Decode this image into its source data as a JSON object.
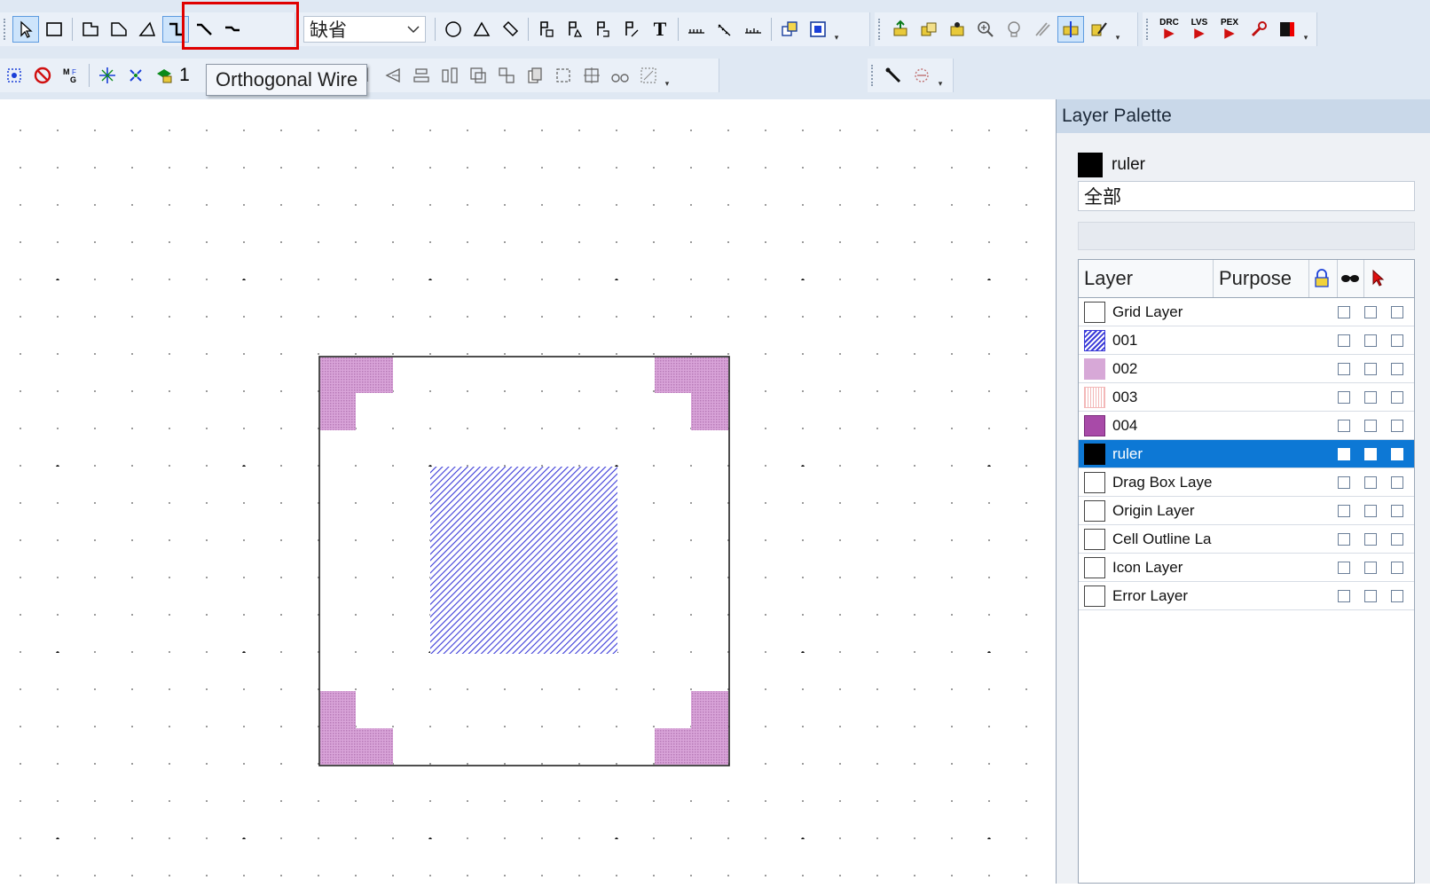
{
  "toolbar": {
    "row1_left_tools": [
      "select-pointer",
      "rectangle",
      "polygon",
      "path-polygon",
      "triangle"
    ],
    "wire_tools": [
      "orthogonal-wire",
      "diagonal-wire",
      "straight-wire"
    ],
    "purpose_dropdown": "缺省",
    "shape_tools": [
      "circle",
      "triangle",
      "ellipse-slash"
    ],
    "pin_tools": [
      "pin-p1",
      "pin-p2",
      "pin-p3",
      "pin-p4"
    ],
    "text_tool": "T",
    "drc_label": "DRC",
    "lvs_label": "LVS",
    "pex_label": "PEX",
    "partial_text": "1"
  },
  "tooltip": {
    "text": "Orthogonal Wire"
  },
  "palette": {
    "title": "Layer Palette",
    "current_layer": "ruler",
    "filter_value": "全部",
    "columns": {
      "layer": "Layer",
      "purpose": "Purpose"
    },
    "layers": [
      {
        "name": "Grid Layer",
        "swatch": "empty",
        "selected": false
      },
      {
        "name": "001",
        "swatch": "blue-hatch",
        "selected": false
      },
      {
        "name": "002",
        "swatch": "light-purple",
        "selected": false
      },
      {
        "name": "003",
        "swatch": "pink-dots",
        "selected": false
      },
      {
        "name": "004",
        "swatch": "purple",
        "selected": false
      },
      {
        "name": "ruler",
        "swatch": "black",
        "selected": true
      },
      {
        "name": "Drag Box Laye",
        "swatch": "empty",
        "selected": false
      },
      {
        "name": "Origin Layer",
        "swatch": "empty",
        "selected": false
      },
      {
        "name": "Cell Outline La",
        "swatch": "empty",
        "selected": false
      },
      {
        "name": "Icon Layer",
        "swatch": "empty",
        "selected": false
      },
      {
        "name": "Error Layer",
        "swatch": "empty",
        "selected": false
      }
    ]
  },
  "colors": {
    "accent_selection": "#0d78d5",
    "highlight_red": "#e00000",
    "hatch_blue": "#3b3bd8",
    "pad_purple": "#c88ec8"
  }
}
